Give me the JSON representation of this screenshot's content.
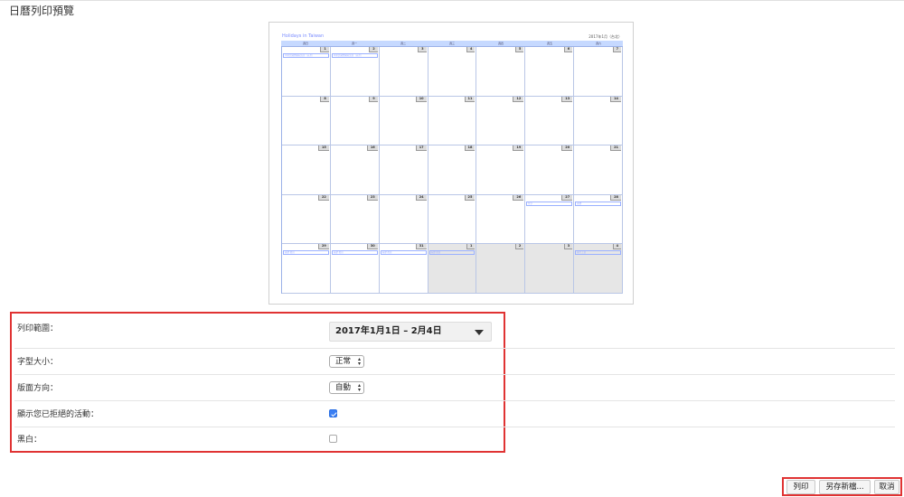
{
  "page": {
    "title": "日曆列印預覽"
  },
  "preview": {
    "calendar_title": "Holidays in Taiwan",
    "header_date": "2017年1月（台北）",
    "weekdays": [
      "週日",
      "週一",
      "週二",
      "週三",
      "週四",
      "週五",
      "週六"
    ],
    "cells": [
      {
        "num": "1",
        "event": "中華民國開國紀念日（元旦）",
        "grey": false
      },
      {
        "num": "2",
        "event": "中華民國開國紀念日（元旦）",
        "grey": false
      },
      {
        "num": "3",
        "event": "",
        "grey": false
      },
      {
        "num": "4",
        "event": "",
        "grey": false
      },
      {
        "num": "5",
        "event": "",
        "grey": false
      },
      {
        "num": "6",
        "event": "",
        "grey": false
      },
      {
        "num": "7",
        "event": "",
        "grey": false
      },
      {
        "num": "8",
        "event": "",
        "grey": false
      },
      {
        "num": "9",
        "event": "",
        "grey": false
      },
      {
        "num": "10",
        "event": "",
        "grey": false
      },
      {
        "num": "11",
        "event": "",
        "grey": false
      },
      {
        "num": "12",
        "event": "",
        "grey": false
      },
      {
        "num": "13",
        "event": "",
        "grey": false
      },
      {
        "num": "14",
        "event": "",
        "grey": false
      },
      {
        "num": "15",
        "event": "",
        "grey": false
      },
      {
        "num": "16",
        "event": "",
        "grey": false
      },
      {
        "num": "17",
        "event": "",
        "grey": false
      },
      {
        "num": "18",
        "event": "",
        "grey": false
      },
      {
        "num": "19",
        "event": "",
        "grey": false
      },
      {
        "num": "20",
        "event": "",
        "grey": false
      },
      {
        "num": "21",
        "event": "",
        "grey": false
      },
      {
        "num": "22",
        "event": "",
        "grey": false
      },
      {
        "num": "23",
        "event": "",
        "grey": false
      },
      {
        "num": "24",
        "event": "",
        "grey": false
      },
      {
        "num": "25",
        "event": "",
        "grey": false
      },
      {
        "num": "26",
        "event": "",
        "grey": false
      },
      {
        "num": "27",
        "event": "除夕",
        "grey": false
      },
      {
        "num": "28",
        "event": "春節",
        "grey": false
      },
      {
        "num": "29",
        "event": "春節 假日",
        "grey": false
      },
      {
        "num": "30",
        "event": "春節 假日",
        "grey": false
      },
      {
        "num": "31",
        "event": "春節 假日",
        "grey": false
      },
      {
        "num": "1",
        "event": "春節 假日",
        "grey": true
      },
      {
        "num": "2",
        "event": "",
        "grey": true
      },
      {
        "num": "3",
        "event": "",
        "grey": true
      },
      {
        "num": "4",
        "event": "補行上班",
        "grey": true
      }
    ]
  },
  "options": {
    "range": {
      "label": "列印範圍：",
      "value": "2017年1月1日 – 2月4日"
    },
    "font_size": {
      "label": "字型大小：",
      "value": "正常"
    },
    "orientation": {
      "label": "版面方向：",
      "value": "自動"
    },
    "show_declined": {
      "label": "顯示您已拒絕的活動：",
      "checked": true
    },
    "black_white": {
      "label": "黑白：",
      "checked": false
    }
  },
  "actions": {
    "print": "列印",
    "save_as": "另存新檔...",
    "cancel": "取消"
  },
  "colors": {
    "highlight": "#e03333",
    "checkbox": "#3b7ff3",
    "calendar_accent": "#7a8cff"
  },
  "icons": {
    "dropdown": "triangle-down-icon",
    "select": "up-down-arrows-icon",
    "check": "checkmark-icon"
  }
}
